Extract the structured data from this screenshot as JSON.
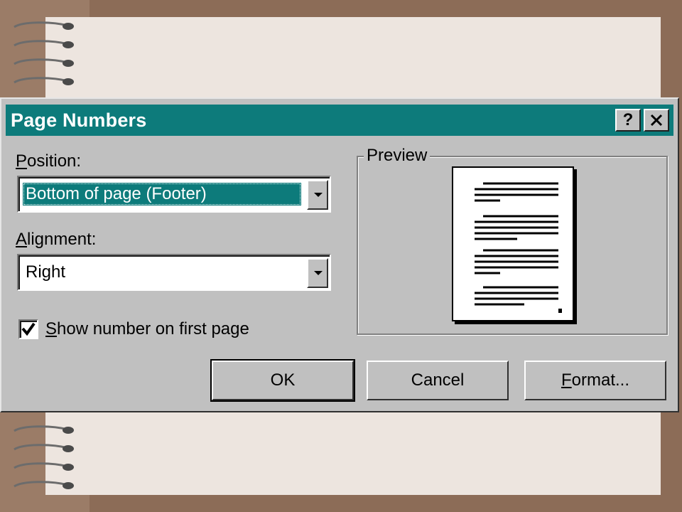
{
  "dialog": {
    "title": "Page Numbers",
    "help_icon": "question-icon",
    "close_icon": "close-icon"
  },
  "position": {
    "label": "Position:",
    "accesskey": "P",
    "value": "Bottom of page (Footer)"
  },
  "alignment": {
    "label": "Alignment:",
    "accesskey": "A",
    "value": "Right"
  },
  "show_first": {
    "label": "Show number on first page",
    "accesskey": "S",
    "checked": true
  },
  "preview": {
    "legend": "Preview"
  },
  "buttons": {
    "ok": "OK",
    "cancel": "Cancel",
    "format": "Format...",
    "format_accesskey": "F"
  },
  "colors": {
    "titlebar": "#0d7b7b",
    "dialog": "#c0c0c0",
    "background": "#8c6c57",
    "paper": "#ede5df"
  }
}
